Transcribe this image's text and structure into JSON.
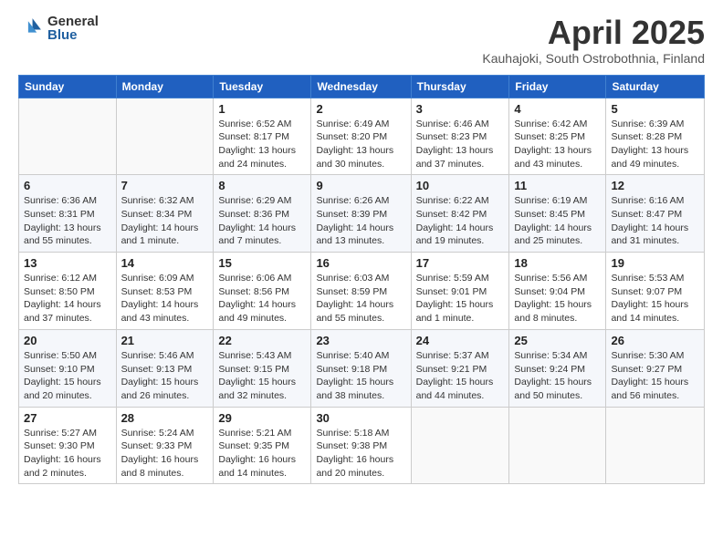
{
  "header": {
    "logo_general": "General",
    "logo_blue": "Blue",
    "month_title": "April 2025",
    "subtitle": "Kauhajoki, South Ostrobothnia, Finland"
  },
  "weekdays": [
    "Sunday",
    "Monday",
    "Tuesday",
    "Wednesday",
    "Thursday",
    "Friday",
    "Saturday"
  ],
  "weeks": [
    [
      {
        "day": "",
        "info": ""
      },
      {
        "day": "",
        "info": ""
      },
      {
        "day": "1",
        "info": "Sunrise: 6:52 AM\nSunset: 8:17 PM\nDaylight: 13 hours and 24 minutes."
      },
      {
        "day": "2",
        "info": "Sunrise: 6:49 AM\nSunset: 8:20 PM\nDaylight: 13 hours and 30 minutes."
      },
      {
        "day": "3",
        "info": "Sunrise: 6:46 AM\nSunset: 8:23 PM\nDaylight: 13 hours and 37 minutes."
      },
      {
        "day": "4",
        "info": "Sunrise: 6:42 AM\nSunset: 8:25 PM\nDaylight: 13 hours and 43 minutes."
      },
      {
        "day": "5",
        "info": "Sunrise: 6:39 AM\nSunset: 8:28 PM\nDaylight: 13 hours and 49 minutes."
      }
    ],
    [
      {
        "day": "6",
        "info": "Sunrise: 6:36 AM\nSunset: 8:31 PM\nDaylight: 13 hours and 55 minutes."
      },
      {
        "day": "7",
        "info": "Sunrise: 6:32 AM\nSunset: 8:34 PM\nDaylight: 14 hours and 1 minute."
      },
      {
        "day": "8",
        "info": "Sunrise: 6:29 AM\nSunset: 8:36 PM\nDaylight: 14 hours and 7 minutes."
      },
      {
        "day": "9",
        "info": "Sunrise: 6:26 AM\nSunset: 8:39 PM\nDaylight: 14 hours and 13 minutes."
      },
      {
        "day": "10",
        "info": "Sunrise: 6:22 AM\nSunset: 8:42 PM\nDaylight: 14 hours and 19 minutes."
      },
      {
        "day": "11",
        "info": "Sunrise: 6:19 AM\nSunset: 8:45 PM\nDaylight: 14 hours and 25 minutes."
      },
      {
        "day": "12",
        "info": "Sunrise: 6:16 AM\nSunset: 8:47 PM\nDaylight: 14 hours and 31 minutes."
      }
    ],
    [
      {
        "day": "13",
        "info": "Sunrise: 6:12 AM\nSunset: 8:50 PM\nDaylight: 14 hours and 37 minutes."
      },
      {
        "day": "14",
        "info": "Sunrise: 6:09 AM\nSunset: 8:53 PM\nDaylight: 14 hours and 43 minutes."
      },
      {
        "day": "15",
        "info": "Sunrise: 6:06 AM\nSunset: 8:56 PM\nDaylight: 14 hours and 49 minutes."
      },
      {
        "day": "16",
        "info": "Sunrise: 6:03 AM\nSunset: 8:59 PM\nDaylight: 14 hours and 55 minutes."
      },
      {
        "day": "17",
        "info": "Sunrise: 5:59 AM\nSunset: 9:01 PM\nDaylight: 15 hours and 1 minute."
      },
      {
        "day": "18",
        "info": "Sunrise: 5:56 AM\nSunset: 9:04 PM\nDaylight: 15 hours and 8 minutes."
      },
      {
        "day": "19",
        "info": "Sunrise: 5:53 AM\nSunset: 9:07 PM\nDaylight: 15 hours and 14 minutes."
      }
    ],
    [
      {
        "day": "20",
        "info": "Sunrise: 5:50 AM\nSunset: 9:10 PM\nDaylight: 15 hours and 20 minutes."
      },
      {
        "day": "21",
        "info": "Sunrise: 5:46 AM\nSunset: 9:13 PM\nDaylight: 15 hours and 26 minutes."
      },
      {
        "day": "22",
        "info": "Sunrise: 5:43 AM\nSunset: 9:15 PM\nDaylight: 15 hours and 32 minutes."
      },
      {
        "day": "23",
        "info": "Sunrise: 5:40 AM\nSunset: 9:18 PM\nDaylight: 15 hours and 38 minutes."
      },
      {
        "day": "24",
        "info": "Sunrise: 5:37 AM\nSunset: 9:21 PM\nDaylight: 15 hours and 44 minutes."
      },
      {
        "day": "25",
        "info": "Sunrise: 5:34 AM\nSunset: 9:24 PM\nDaylight: 15 hours and 50 minutes."
      },
      {
        "day": "26",
        "info": "Sunrise: 5:30 AM\nSunset: 9:27 PM\nDaylight: 15 hours and 56 minutes."
      }
    ],
    [
      {
        "day": "27",
        "info": "Sunrise: 5:27 AM\nSunset: 9:30 PM\nDaylight: 16 hours and 2 minutes."
      },
      {
        "day": "28",
        "info": "Sunrise: 5:24 AM\nSunset: 9:33 PM\nDaylight: 16 hours and 8 minutes."
      },
      {
        "day": "29",
        "info": "Sunrise: 5:21 AM\nSunset: 9:35 PM\nDaylight: 16 hours and 14 minutes."
      },
      {
        "day": "30",
        "info": "Sunrise: 5:18 AM\nSunset: 9:38 PM\nDaylight: 16 hours and 20 minutes."
      },
      {
        "day": "",
        "info": ""
      },
      {
        "day": "",
        "info": ""
      },
      {
        "day": "",
        "info": ""
      }
    ]
  ]
}
